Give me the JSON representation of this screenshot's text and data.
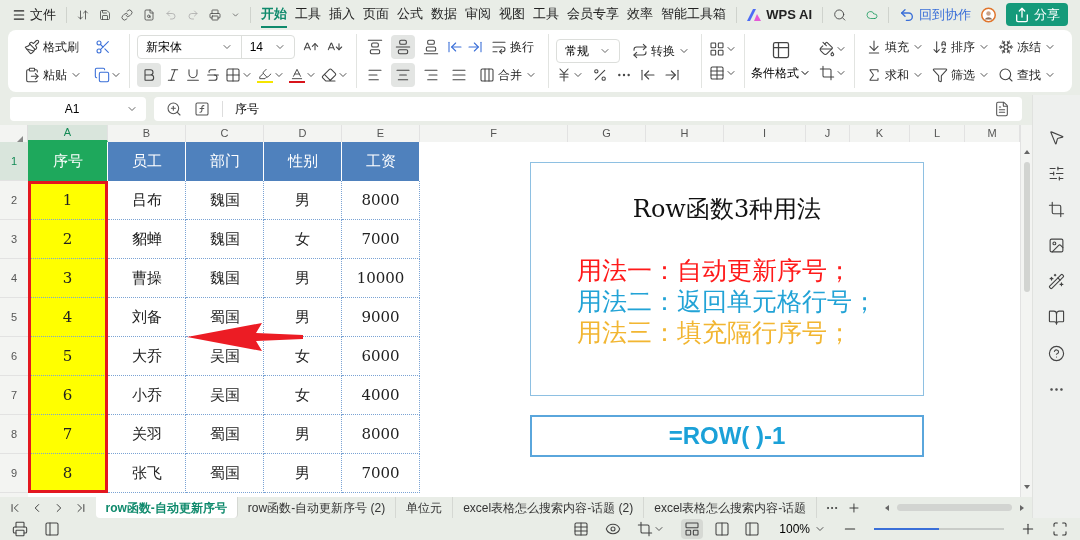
{
  "menu_bar": {
    "file": "文件",
    "tabs": [
      {
        "label": "开始",
        "selected": true
      },
      {
        "label": "工具",
        "selected": false
      },
      {
        "label": "插入",
        "selected": false
      },
      {
        "label": "页面",
        "selected": false
      },
      {
        "label": "公式",
        "selected": false
      },
      {
        "label": "数据",
        "selected": false
      },
      {
        "label": "审阅",
        "selected": false
      },
      {
        "label": "视图",
        "selected": false
      },
      {
        "label": "工具",
        "selected": false
      },
      {
        "label": "会员专享",
        "selected": false
      },
      {
        "label": "效率",
        "selected": false
      },
      {
        "label": "智能工具箱",
        "selected": false
      }
    ],
    "ai": "WPS AI",
    "collab": "回到协作",
    "share": "分享"
  },
  "ribbon": {
    "format_painter": "格式刷",
    "paste": "粘贴",
    "font": "新宋体",
    "font_size": "14",
    "bold_on": true,
    "vertical_align": [
      {
        "selected": false
      },
      {
        "selected": true
      },
      {
        "selected": false
      }
    ],
    "horizontal_align": [
      {
        "selected": false
      },
      {
        "selected": true
      },
      {
        "selected": false
      },
      {
        "selected": false
      }
    ],
    "wrap": "换行",
    "merge": "合并",
    "number_format": "常规",
    "convert": "转换",
    "conditional_format": "条件格式",
    "fill": "填充",
    "sort": "排序",
    "freeze": "冻结",
    "sum": "求和",
    "filter": "筛选",
    "find": "查找"
  },
  "formula_bar": {
    "cell_ref": "A1",
    "content": "序号"
  },
  "column_headers": [
    {
      "label": "A",
      "selected": true
    },
    {
      "label": "B",
      "selected": false
    },
    {
      "label": "C",
      "selected": false
    },
    {
      "label": "D",
      "selected": false
    },
    {
      "label": "E",
      "selected": false
    },
    {
      "label": "F",
      "selected": false
    },
    {
      "label": "G",
      "selected": false
    },
    {
      "label": "H",
      "selected": false
    },
    {
      "label": "I",
      "selected": false
    },
    {
      "label": "J",
      "selected": false
    },
    {
      "label": "K",
      "selected": false
    },
    {
      "label": "L",
      "selected": false
    },
    {
      "label": "M",
      "selected": false
    }
  ],
  "row_headers": [
    {
      "label": "1",
      "selected": true
    },
    {
      "label": "2",
      "selected": false
    },
    {
      "label": "3",
      "selected": false
    },
    {
      "label": "4",
      "selected": false
    },
    {
      "label": "5",
      "selected": false
    },
    {
      "label": "6",
      "selected": false
    },
    {
      "label": "7",
      "selected": false
    },
    {
      "label": "8",
      "selected": false
    },
    {
      "label": "9",
      "selected": false
    }
  ],
  "table": [
    {
      "header": "序号",
      "color": "#1ea85c",
      "highlighted": true,
      "outlined": true,
      "cells": [
        "1",
        "2",
        "3",
        "4",
        "5",
        "6",
        "7",
        "8"
      ]
    },
    {
      "header": "员工",
      "color": "#4f81bd",
      "cells": [
        "吕布",
        "貂蝉",
        "曹操",
        "刘备",
        "大乔",
        "小乔",
        "关羽",
        "张飞"
      ]
    },
    {
      "header": "部门",
      "color": "#4f81bd",
      "cells": [
        "魏国",
        "魏国",
        "魏国",
        "蜀国",
        "吴国",
        "吴国",
        "蜀国",
        "蜀国"
      ]
    },
    {
      "header": "性别",
      "color": "#4f81bd",
      "cells": [
        "男",
        "女",
        "男",
        "男",
        "女",
        "女",
        "男",
        "男"
      ]
    },
    {
      "header": "工资",
      "color": "#4f81bd",
      "cells": [
        "8000",
        "7000",
        "10000",
        "9000",
        "6000",
        "4000",
        "8000",
        "7000"
      ]
    }
  ],
  "note_box": {
    "title": "Row函数3种用法",
    "lines": [
      {
        "text": "用法一：自动更新序号；",
        "color": "#ff1a1a"
      },
      {
        "text": "用法二：返回单元格行号；",
        "color": "#22a3d6"
      },
      {
        "text": "用法三：填充隔行序号；",
        "color": "#f2b632"
      }
    ]
  },
  "formula_box": {
    "text": "=ROW( )-1"
  },
  "sheet_tabs": [
    {
      "label": "row函数-自动更新序号",
      "selected": true
    },
    {
      "label": "row函数-自动更新序号 (2)",
      "selected": false
    },
    {
      "label": "单位元",
      "selected": false
    },
    {
      "label": "excel表格怎么搜索内容-话题 (2)",
      "selected": false
    },
    {
      "label": "excel表格怎么搜索内容-话题",
      "selected": false
    }
  ],
  "status_bar": {
    "view_buttons": [
      {
        "kind": "normal",
        "selected": true
      },
      {
        "kind": "split",
        "selected": false
      },
      {
        "kind": "page",
        "selected": false
      }
    ],
    "zoom": "100%",
    "zoom_slider": {
      "level": 0.5
    }
  }
}
